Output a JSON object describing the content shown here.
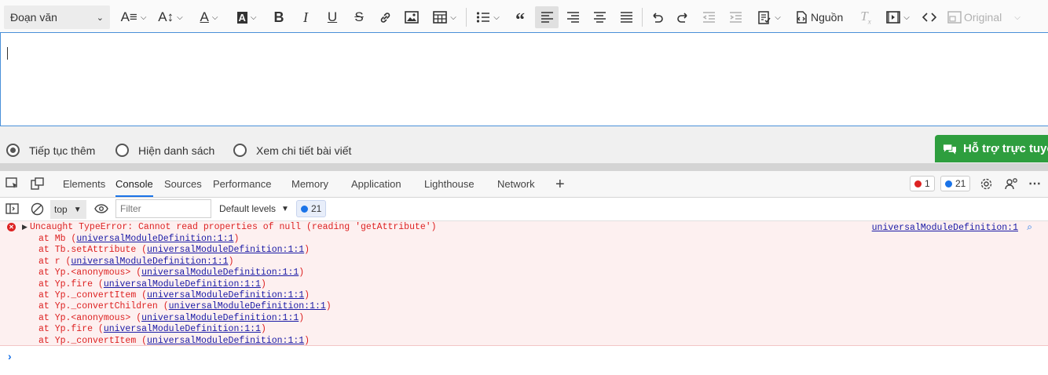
{
  "toolbar": {
    "heading": "Đoạn văn",
    "source_label": "Nguồn",
    "original_label": "Original",
    "icons": [
      "font-size-icon",
      "font-family-icon",
      "font-color-icon",
      "font-background-icon",
      "bold-icon",
      "italic-icon",
      "underline-icon",
      "strikethrough-icon",
      "link-icon",
      "image-icon",
      "table-icon",
      "bulleted-list-icon",
      "blockquote-icon",
      "align-left-icon",
      "align-right-icon",
      "align-center-icon",
      "align-justify-icon",
      "undo-icon",
      "redo-icon",
      "outdent-icon",
      "indent-icon",
      "paste-from-office-icon",
      "source-icon",
      "remove-format-icon",
      "media-icon",
      "code-icon",
      "original-icon"
    ]
  },
  "options": {
    "continue": "Tiếp tục thêm",
    "show_list": "Hiện danh sách",
    "view_detail": "Xem chi tiết bài viết"
  },
  "support": {
    "label": "Hỗ trợ trực tuyến"
  },
  "devtools": {
    "tabs": [
      "Elements",
      "Console",
      "Sources",
      "Performance",
      "Memory",
      "Application",
      "Lighthouse",
      "Network"
    ],
    "active_tab": "Console",
    "error_count": "1",
    "message_count": "21",
    "context": "top",
    "filter_placeholder": "Filter",
    "levels": "Default levels",
    "levels_count": "21",
    "colors": {
      "error": "#dd2222",
      "link": "#1a1aa6",
      "accent": "#1a73e8"
    }
  },
  "console": {
    "error_message": "Uncaught TypeError: Cannot read properties of null (reading 'getAttribute')",
    "source": "universalModuleDefinition:1",
    "stack": [
      {
        "fn": "at Mb (",
        "loc": "universalModuleDefinition:1:1",
        "end": ")"
      },
      {
        "fn": "at Tb.setAttribute (",
        "loc": "universalModuleDefinition:1:1",
        "end": ")"
      },
      {
        "fn": "at r (",
        "loc": "universalModuleDefinition:1:1",
        "end": ")"
      },
      {
        "fn": "at Yp.<anonymous> (",
        "loc": "universalModuleDefinition:1:1",
        "end": ")"
      },
      {
        "fn": "at Yp.fire (",
        "loc": "universalModuleDefinition:1:1",
        "end": ")"
      },
      {
        "fn": "at Yp._convertItem (",
        "loc": "universalModuleDefinition:1:1",
        "end": ")"
      },
      {
        "fn": "at Yp._convertChildren (",
        "loc": "universalModuleDefinition:1:1",
        "end": ")"
      },
      {
        "fn": "at Yp.<anonymous> (",
        "loc": "universalModuleDefinition:1:1",
        "end": ")"
      },
      {
        "fn": "at Yp.fire (",
        "loc": "universalModuleDefinition:1:1",
        "end": ")"
      },
      {
        "fn": "at Yp._convertItem (",
        "loc": "universalModuleDefinition:1:1",
        "end": ")"
      }
    ]
  }
}
